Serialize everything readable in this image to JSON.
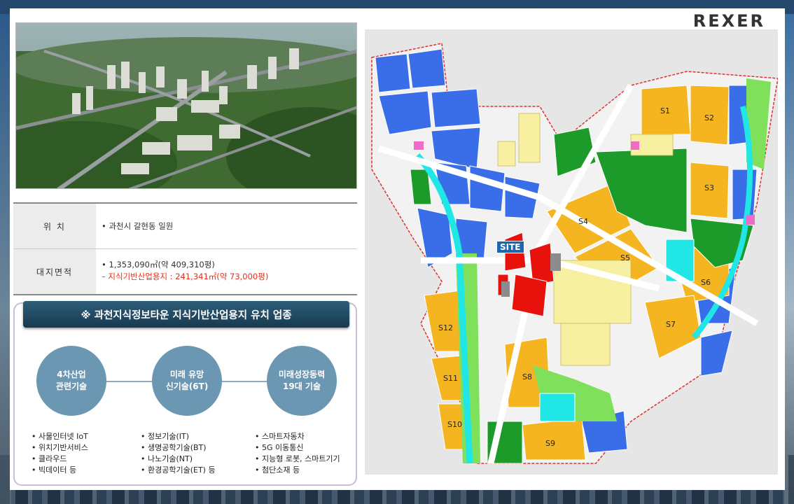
{
  "brand": {
    "logo": "REXER"
  },
  "info": {
    "location_key": "위    치",
    "location_val": "• 과천시 갈현동 일원",
    "area_key": "대지면적",
    "area_val1": "• 1,353,090㎡(약 409,310평)",
    "area_val2": "– 지식기반산업용지 : 241,341㎡(약 73,000평)"
  },
  "section": {
    "title": "※ 과천지식정보타운 지식기반산업용지 유치 업종",
    "circles": [
      {
        "label": "4차산업\n관련기술"
      },
      {
        "label": "미래 유망\n신기술(6T)"
      },
      {
        "label": "미래성장동력\n19대 기술"
      }
    ],
    "lists": [
      [
        "• 사물인터넷 IoT",
        "• 위치기반서비스",
        "• 클라우드",
        "• 빅데이터 등"
      ],
      [
        "• 정보기술(IT)",
        "• 생명공학기술(BT)",
        "• 나노기술(NT)",
        "• 환경공학기술(ET) 등"
      ],
      [
        "• 스마트자동차",
        "• 5G 이동통신",
        "• 지능형 로봇, 스마트기기",
        "• 첨단소재 등"
      ]
    ]
  },
  "map": {
    "site_label": "SITE",
    "blocks": [
      "S1",
      "S2",
      "S3",
      "S4",
      "S5",
      "S6",
      "S7",
      "S8",
      "S9",
      "S10",
      "S11",
      "S12"
    ],
    "colors": {
      "school_orange": "#f5b520",
      "research_blue": "#3a6ee8",
      "park_green": "#1c9a2a",
      "site_red": "#e8120c",
      "residential_yellow": "#f7f0a0",
      "water_cyan": "#21e6e6"
    }
  }
}
